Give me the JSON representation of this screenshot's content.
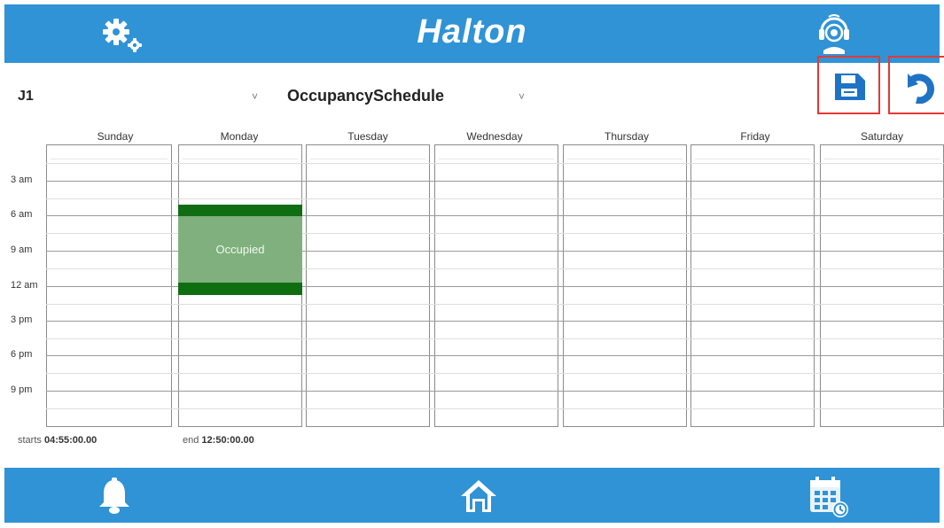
{
  "header": {
    "logo_text": "Halton",
    "settings_icon": "gear-icon",
    "support_icon": "support-headset-icon",
    "bar_color": "#2f93d6"
  },
  "toolbar": {
    "zone_value": "J1",
    "zone_caret": "˅",
    "schedule_value": "OccupancySchedule",
    "schedule_caret": "˅",
    "save_icon": "save-icon",
    "undo_icon": "undo-icon",
    "highlight_color": "#e53935",
    "icon_color": "#1f73c4"
  },
  "days": [
    "Sunday",
    "Monday",
    "Tuesday",
    "Wednesday",
    "Thursday",
    "Friday",
    "Saturday"
  ],
  "time_labels": [
    "3 am",
    "6 am",
    "9 am",
    "12 am",
    "3 pm",
    "6 pm",
    "9 pm"
  ],
  "event": {
    "day": "Monday",
    "label": "Occupied",
    "bar_color": "#0f6e12",
    "fill_color": "#7fb07d"
  },
  "footer_info": {
    "start_label": "starts",
    "start_value": "04:55:00.00",
    "end_label": "end",
    "end_value": "12:50:00.00"
  },
  "bottom_nav": {
    "alarm_icon": "bell-icon",
    "home_icon": "home-icon",
    "calendar_icon": "calendar-icon"
  }
}
